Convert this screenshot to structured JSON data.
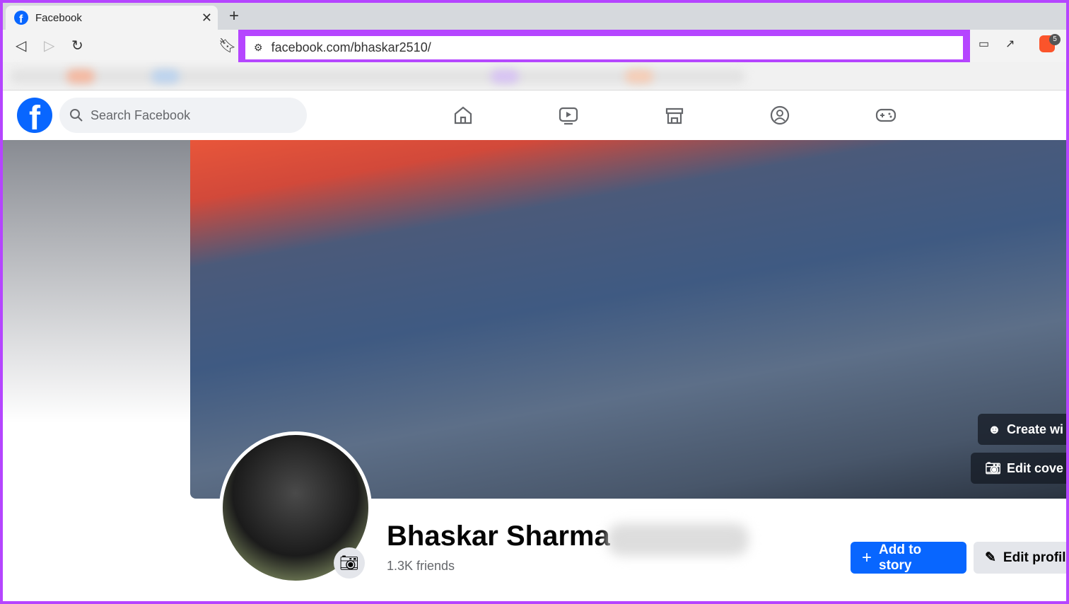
{
  "browser": {
    "tab_title": "Facebook",
    "url": "facebook.com/bhaskar2510/",
    "extension_badge": "5",
    "highlight_color": "#b545ff"
  },
  "nav": {
    "search_placeholder": "Search Facebook",
    "icons": [
      "home-icon",
      "video-icon",
      "marketplace-icon",
      "groups-icon",
      "gaming-icon"
    ],
    "brand_color": "#0866ff"
  },
  "profile": {
    "name": "Bhaskar Sharma",
    "friends": "1.3K friends",
    "create_button": "Create wi",
    "edit_cover_button": "Edit cove",
    "add_story_button": "Add to story",
    "edit_profile_button": "Edit profile"
  }
}
